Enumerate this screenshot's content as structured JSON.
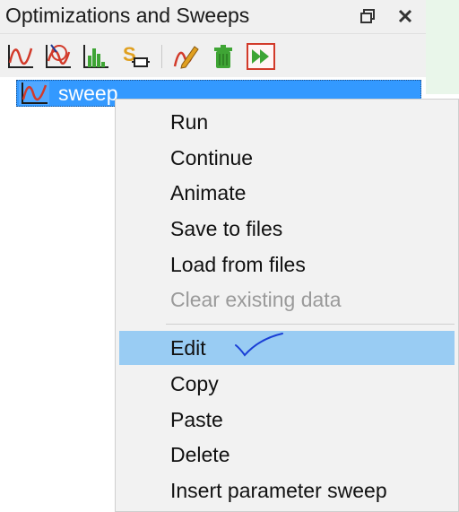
{
  "panel": {
    "title": "Optimizations and Sweeps",
    "restore_icon": "restore-window-icon",
    "close_icon": "close-icon"
  },
  "toolbar": {
    "tools": [
      {
        "name": "insert-sweep-tool",
        "icon": "sweep-curve-icon"
      },
      {
        "name": "insert-optimization-tool",
        "icon": "optimization-icon"
      },
      {
        "name": "insert-yield-tool",
        "icon": "histogram-icon"
      },
      {
        "name": "insert-s-param-tool",
        "icon": "s-parameter-icon"
      },
      {
        "name": "edit-tool",
        "icon": "pencil-icon"
      },
      {
        "name": "delete-tool",
        "icon": "trash-icon"
      },
      {
        "name": "run-tool",
        "icon": "fast-forward-icon"
      }
    ],
    "colors": {
      "red": "#d23a2a",
      "green": "#3fa535",
      "navy": "#1f3a93",
      "gold": "#e0a020"
    }
  },
  "tree": {
    "items": [
      {
        "label": "sweep",
        "selected": true,
        "icon": "sweep-curve-icon"
      }
    ]
  },
  "context_menu": {
    "items": [
      {
        "label": "Run",
        "enabled": true
      },
      {
        "label": "Continue",
        "enabled": true
      },
      {
        "label": "Animate",
        "enabled": true
      },
      {
        "label": "Save to files",
        "enabled": true
      },
      {
        "label": "Load from files",
        "enabled": true
      },
      {
        "label": "Clear existing data",
        "enabled": false
      },
      {
        "label": "Edit",
        "enabled": true,
        "highlighted": true
      },
      {
        "label": "Copy",
        "enabled": true
      },
      {
        "label": "Paste",
        "enabled": true
      },
      {
        "label": "Delete",
        "enabled": true
      },
      {
        "label": "Insert parameter sweep",
        "enabled": true
      }
    ],
    "highlight_color": "#99ccf3",
    "annotation": "handwritten-checkmark"
  }
}
